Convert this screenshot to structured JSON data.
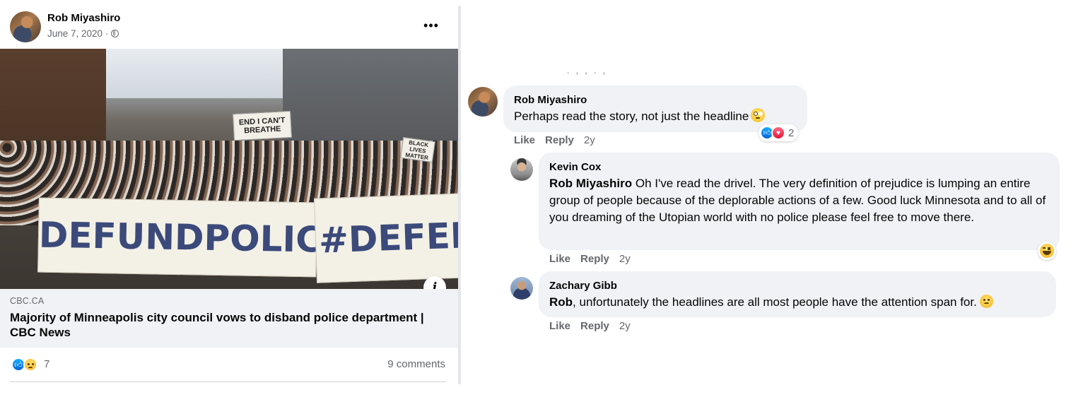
{
  "post": {
    "author": "Rob Miyashiro",
    "date": "June 7, 2020 ·",
    "privacy_icon": "globe-icon",
    "more_label": "•••",
    "link": {
      "image_signs": [
        "END I CAN'T BREATHE",
        "BLACK LIVES MATTER"
      ],
      "banner_left": "#DEFUNDPOLICE",
      "banner_right": "#DEFEND BL",
      "info_label": "i",
      "domain": "CBC.CA",
      "title": "Majority of Minneapolis city council vows to disband police department | CBC News"
    },
    "reactions": {
      "icons": [
        "like-icon",
        "sad-icon"
      ],
      "count": "7"
    },
    "comments_count": "9 comments"
  },
  "comments": [
    {
      "author": "Rob Miyashiro",
      "text": "Perhaps read the story, not just the headline",
      "emoji": "rolling-eyes-emoji",
      "actions": {
        "like": "Like",
        "reply": "Reply",
        "time": "2y"
      },
      "reactions": {
        "icons": [
          "like-icon",
          "love-icon"
        ],
        "count": "2"
      }
    },
    {
      "author": "Kevin Cox",
      "mention": "Rob Miyashiro",
      "text": " Oh I've read the drivel. The very definition of prejudice is lumping an entire group of people because of the deplorable actions of a few. Good luck Minnesota and to all of you dreaming of the Utopian world with no police please feel free to move there.",
      "actions": {
        "like": "Like",
        "reply": "Reply",
        "time": "2y"
      },
      "reactions": {
        "icons": [
          "haha-icon"
        ]
      }
    },
    {
      "author": "Zachary Gibb",
      "mention": "Rob",
      "text": ", unfortunately the headlines are all most people have the attention span for.",
      "emoji": "sad-emoji",
      "actions": {
        "like": "Like",
        "reply": "Reply",
        "time": "2y"
      }
    }
  ],
  "colors": {
    "bubble": "#f0f2f5",
    "secondary_text": "#65676b",
    "like_blue": "#1877f2",
    "love_red": "#f33e58"
  }
}
